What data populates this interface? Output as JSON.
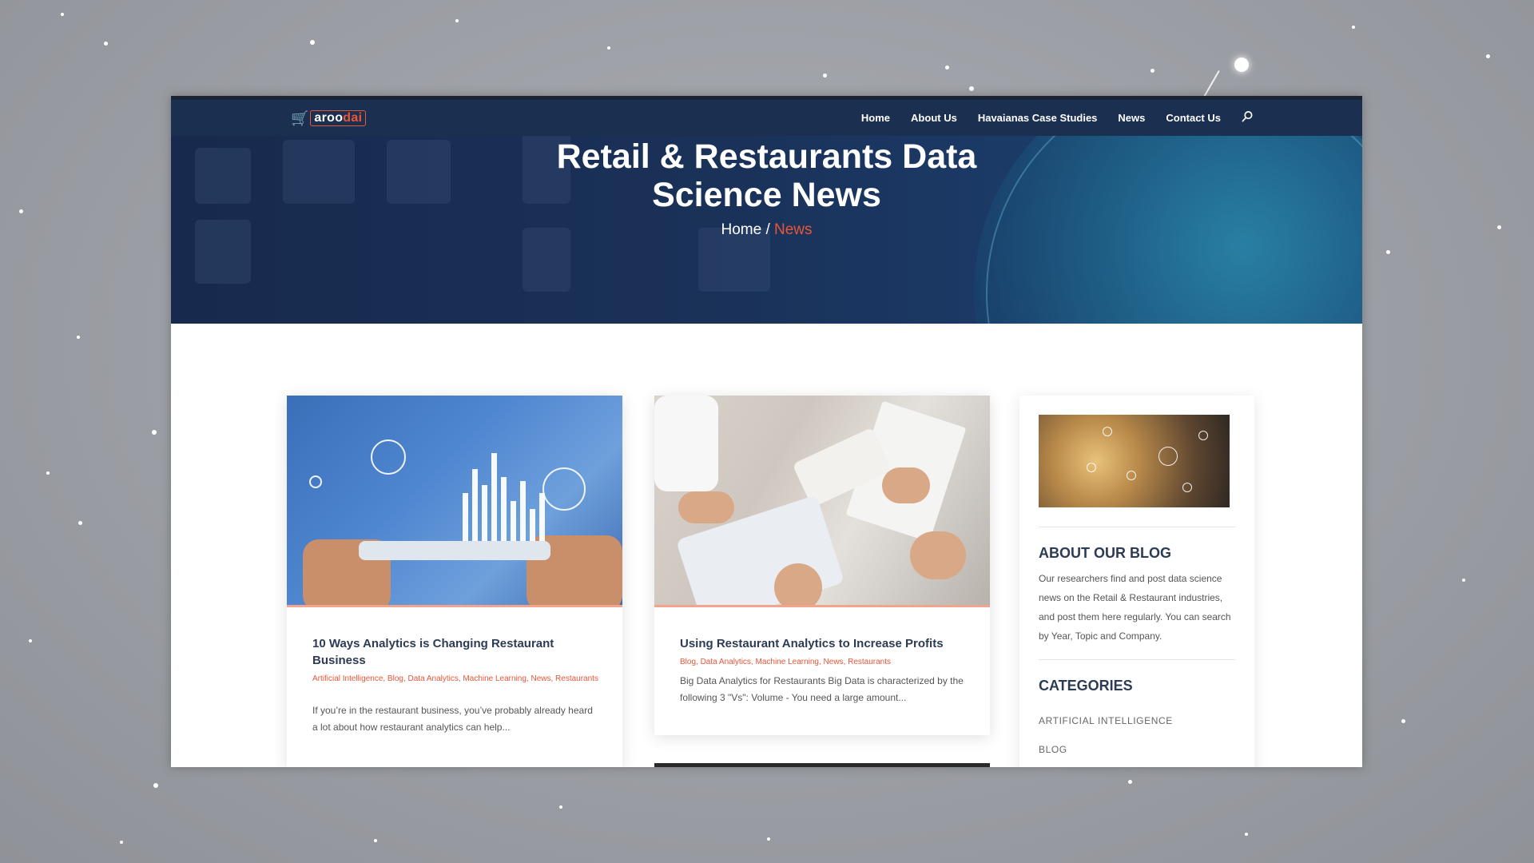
{
  "brand": {
    "logo_prefix": "aroo",
    "logo_accent": "dai"
  },
  "nav": {
    "items": [
      "Home",
      "About Us",
      "Havaianas Case Studies",
      "News",
      "Contact Us"
    ]
  },
  "hero": {
    "title": "Retail & Restaurants Data Science News",
    "breadcrumb_home": "Home",
    "breadcrumb_sep": "/",
    "breadcrumb_current": "News"
  },
  "posts": [
    {
      "title": "10 Ways Analytics is Changing Restaurant Business",
      "categories": "Artificial Intelligence, Blog, Data Analytics, Machine Learning, News, Restaurants",
      "excerpt": "If you’re in the restaurant business, you’ve probably already heard a lot about how restaurant analytics can help..."
    },
    {
      "title": "Using Restaurant Analytics to Increase Profits",
      "categories": "Blog, Data Analytics, Machine Learning, News, Restaurants",
      "excerpt": "Big Data Analytics for Restaurants Big Data is characterized by the following 3 \"Vs\": Volume - You need a large amount..."
    }
  ],
  "sidebar": {
    "about_heading": "ABOUT OUR BLOG",
    "about_text": "Our researchers find and post data science news on the Retail & Restaurant industries, and post them here regularly. You can search by Year, Topic and Company.",
    "categories_heading": "CATEGORIES",
    "categories": [
      "ARTIFICIAL INTELLIGENCE",
      "BLOG"
    ]
  },
  "colors": {
    "accent": "#e8563a",
    "navy": "#1b3050",
    "heading": "#2d3b55"
  },
  "icons": {
    "search": "search-icon",
    "cart": "cart-icon"
  }
}
